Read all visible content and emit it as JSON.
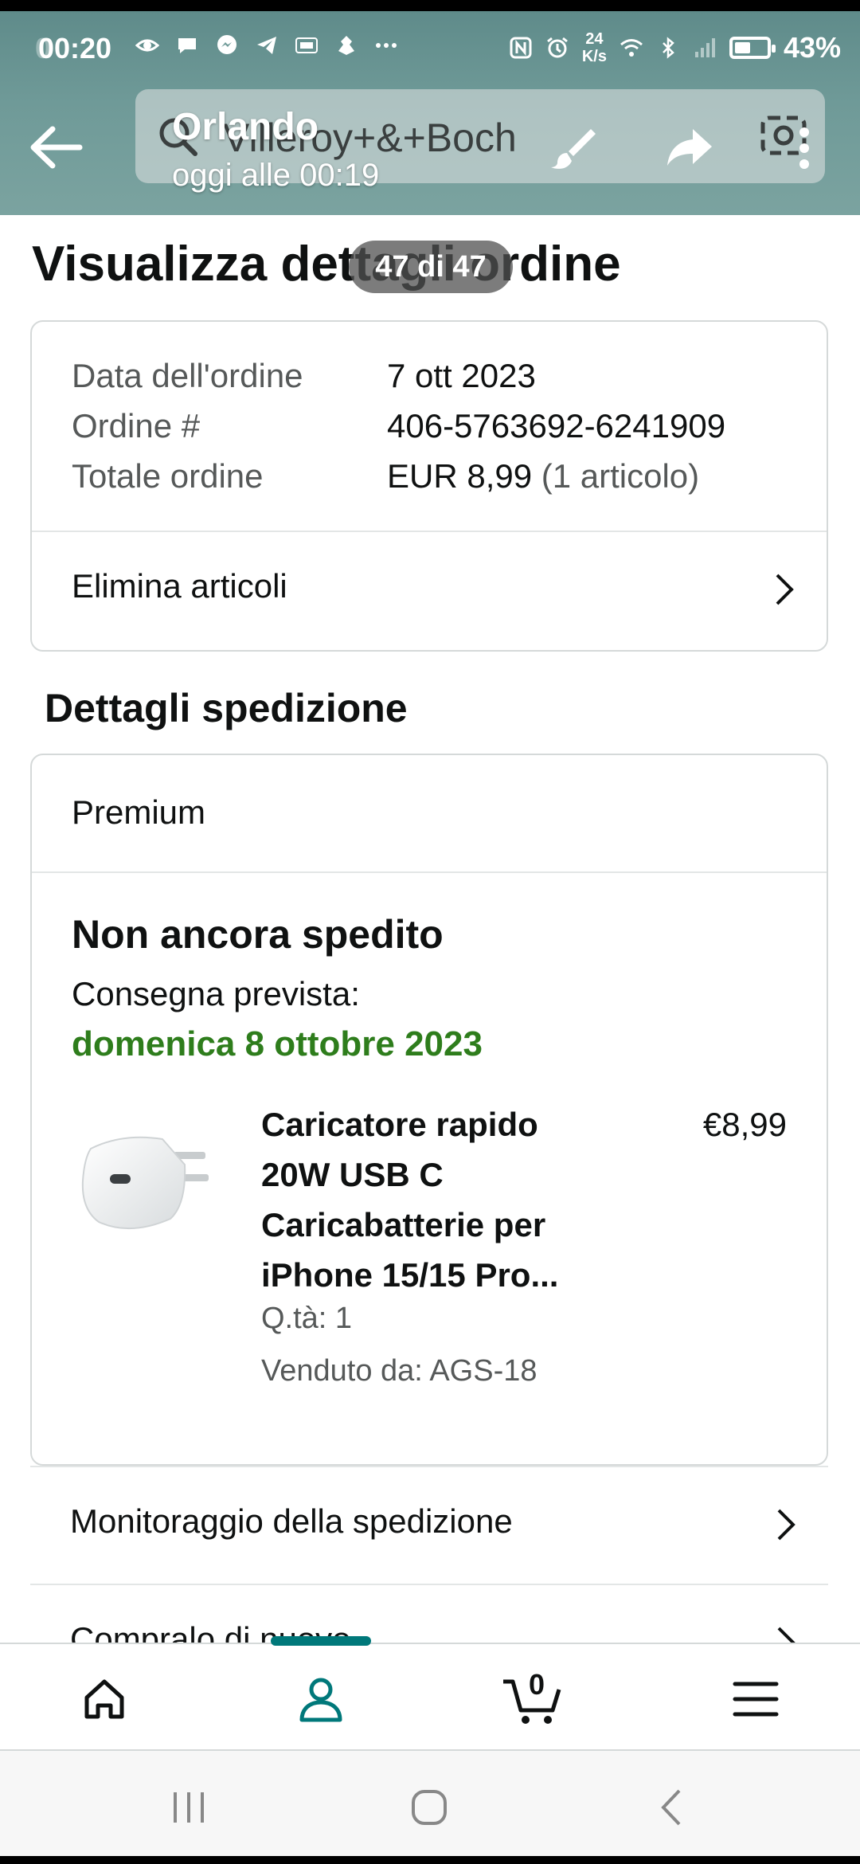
{
  "status_bar": {
    "time": "00:20",
    "time_ghost": "0",
    "net_speed_value": "24",
    "net_speed_unit": "K/s",
    "battery_percent": "43%",
    "icons_left": [
      "eye-icon",
      "chat-bubble-icon",
      "messenger-icon",
      "telegram-icon",
      "temu-icon",
      "alien-icon",
      "more-dots-icon"
    ],
    "icons_right": [
      "nfc-icon",
      "alarm-icon",
      "wifi-icon",
      "bluetooth-icon",
      "signal-icon",
      "battery-icon"
    ]
  },
  "gallery_header": {
    "title": "Orlando",
    "subtitle": "oggi alle 00:19",
    "counter": "47 di 47"
  },
  "search": {
    "query": "Villeroy+&+Boch"
  },
  "page": {
    "title": "Visualizza dettagli ordine"
  },
  "order_summary": {
    "rows": [
      {
        "label": "Data dell'ordine",
        "value": "7 ott 2023",
        "extra": ""
      },
      {
        "label": "Ordine #",
        "value": "406-5763692-6241909",
        "extra": ""
      },
      {
        "label": "Totale ordine",
        "value": "EUR 8,99",
        "extra": " (1 articolo)"
      }
    ],
    "delete_items_label": "Elimina articoli"
  },
  "shipping": {
    "section_title": "Dettagli spedizione",
    "method": "Premium",
    "status": "Non ancora spedito",
    "delivery_label": "Consegna prevista:",
    "delivery_date": "domenica 8 ottobre 2023",
    "product": {
      "name": "Caricatore rapido 20W USB C Caricabatterie per iPhone 15/15 Pro...",
      "price": "€8,99",
      "quantity": "Q.tà: 1",
      "seller": "Venduto da: AGS-18"
    }
  },
  "links": {
    "tracking": "Monitoraggio della spedizione",
    "buy_again": "Compralo di nuovo"
  },
  "bottom_nav": {
    "cart_count": "0",
    "active_tab": "account"
  },
  "colors": {
    "header_teal": "#6f9a98",
    "delivery_green": "#2e7d1c",
    "nav_active": "#00787a"
  }
}
